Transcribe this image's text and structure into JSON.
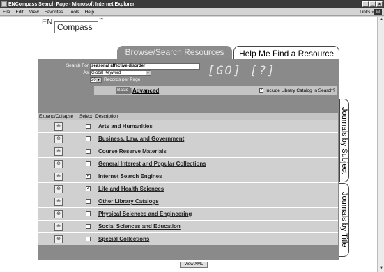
{
  "window": {
    "title": "ENCompass Search Page - Microsoft Internet Explorer",
    "min": "_",
    "max": "□",
    "close": "×"
  },
  "menu": [
    "File",
    "Edit",
    "View",
    "Favorites",
    "Tools",
    "Help"
  ],
  "links": {
    "label": "Links",
    "chevron": "»"
  },
  "logo": {
    "en": "EN",
    "compass": "Compass",
    "tm": "™"
  },
  "tabs": {
    "browse": "Browse/Search Resources",
    "help": "Help Me Find a Resource"
  },
  "search": {
    "for_label": "Search For",
    "query": "seasonal affective disorder",
    "as_label": "As",
    "as_value": "Global Keyword",
    "records_value": "20",
    "records_label": "Records per Page",
    "go": "[GO]",
    "help": "[?]"
  },
  "mode": {
    "basic": "Basic",
    "sep": "|",
    "advanced": "Advanced",
    "include_label": "Include Library Catalog In Search?",
    "include_checked": true
  },
  "table": {
    "headers": [
      "Expand/Collapse",
      "Select",
      "Description"
    ],
    "rows": [
      {
        "label": "Arts and Humanities",
        "checked": false
      },
      {
        "label": "Business, Law, and Government",
        "checked": false
      },
      {
        "label": "Course Reserve Materials",
        "checked": false
      },
      {
        "label": "General Interest and Popular Collections",
        "checked": false
      },
      {
        "label": "Internet Search Engines",
        "checked": true
      },
      {
        "label": "Life and Health Sciences",
        "checked": true
      },
      {
        "label": "Other Library Catalogs",
        "checked": false
      },
      {
        "label": "Physical Sciences and Engineering",
        "checked": false
      },
      {
        "label": "Social Sciences and Education",
        "checked": false
      },
      {
        "label": "Special Collections",
        "checked": false
      }
    ]
  },
  "side_tabs": {
    "subject": "Journals by Subject",
    "title": "Journals by Title"
  },
  "footer": {
    "view_xml": "View XML"
  },
  "icons": {
    "expand": "expand-icon"
  }
}
